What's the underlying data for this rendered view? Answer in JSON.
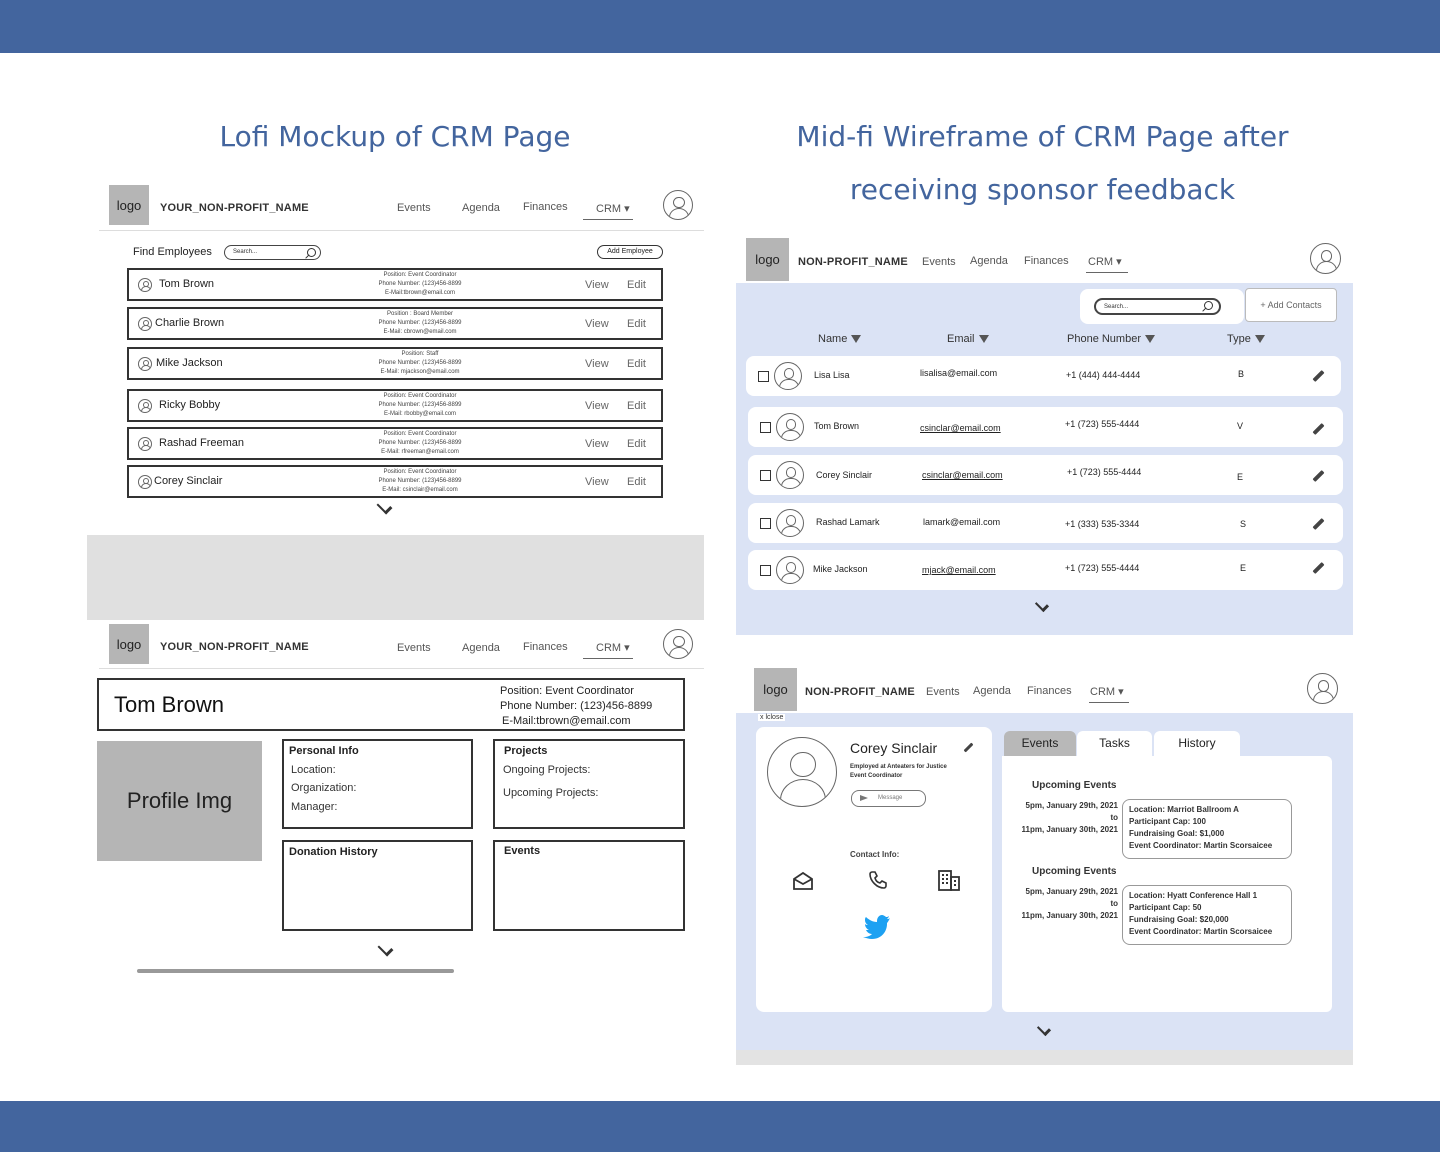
{
  "colors": {
    "accent": "#43659e",
    "midfi_panel": "#dbe3f5"
  },
  "headings": {
    "lofi": "Lofi Mockup of CRM Page",
    "midfi_line1": "Mid-fi Wireframe of CRM Page after",
    "midfi_line2": "receiving sponsor feedback"
  },
  "lofi_list": {
    "logo": "logo",
    "org": "YOUR_NON-PROFIT_NAME",
    "nav": [
      "Events",
      "Agenda",
      "Finances",
      "CRM ▾"
    ],
    "find_label": "Find Employees",
    "search_placeholder": "Search...",
    "add_button": "Add Employee",
    "rows": [
      {
        "name": "Tom Brown",
        "l1": "Position: Event Coordinator",
        "l2": "Phone Number: (123)456-8899",
        "l3": "E-Mail:tbrown@email.com",
        "view": "View",
        "edit": "Edit"
      },
      {
        "name": "Charlie Brown",
        "l1": "Position : Board Member",
        "l2": "Phone Number: (123)456-8899",
        "l3": "E-Mail: cbrown@email.com",
        "view": "View",
        "edit": "Edit"
      },
      {
        "name": "Mike Jackson",
        "l1": "Position: Staff",
        "l2": "Phone Number: (123)456-8899",
        "l3": "E-Mail: mjackson@email.com",
        "view": "View",
        "edit": "Edit"
      },
      {
        "name": "Ricky Bobby",
        "l1": "Position: Event Coordinator",
        "l2": "Phone Number: (123)456-8899",
        "l3": "E-Mail: rbobby@email.com",
        "view": "View",
        "edit": "Edit"
      },
      {
        "name": "Rashad Freeman",
        "l1": "Position: Event Coordinator",
        "l2": "Phone Number: (123)456-8899",
        "l3": "E-Mail: rfreeman@email.com",
        "view": "View",
        "edit": "Edit"
      },
      {
        "name": "Corey Sinclair",
        "l1": "Position: Event Coordinator",
        "l2": "Phone Number: (123)456-8899",
        "l3": "E-Mail: csinclair@email.com",
        "view": "View",
        "edit": "Edit"
      }
    ]
  },
  "lofi_profile": {
    "logo": "logo",
    "org": "YOUR_NON-PROFIT_NAME",
    "nav": [
      "Events",
      "Agenda",
      "Finances",
      "CRM ▾"
    ],
    "name": "Tom Brown",
    "position": "Position: Event Coordinator",
    "phone": "Phone Number: (123)456-8899",
    "email": "E-Mail:tbrown@email.com",
    "profile_img": "Profile Img",
    "personal_info": {
      "title": "Personal Info",
      "fields": [
        "Location:",
        "Organization:",
        "Manager:"
      ]
    },
    "projects": {
      "title": "Projects",
      "fields": [
        "Ongoing Projects:",
        "Upcoming Projects:"
      ]
    },
    "donation_history": "Donation History",
    "events": "Events"
  },
  "midfi_list": {
    "logo": "logo",
    "org": "NON-PROFIT_NAME",
    "nav": [
      "Events",
      "Agenda",
      "Finances",
      "CRM ▾"
    ],
    "search_placeholder": "Search...",
    "add_button": "+ Add Contacts",
    "columns": [
      "Name",
      "Email",
      "Phone Number",
      "Type"
    ],
    "rows": [
      {
        "name": "Lisa Lisa",
        "email": "lisalisa@email.com",
        "phone": "+1 (444) 444-4444",
        "type": "B"
      },
      {
        "name": "Tom Brown",
        "email": "csinclar@email.com",
        "phone": "+1 (723) 555-4444",
        "type": "V"
      },
      {
        "name": "Corey Sinclair",
        "email": "csinclar@email.com",
        "phone": "+1 (723) 555-4444",
        "type": "E"
      },
      {
        "name": "Rashad Lamark",
        "email": "lamark@email.com",
        "phone": "+1 (333) 535-3344",
        "type": "S"
      },
      {
        "name": "Mike Jackson",
        "email": "mjack@email.com",
        "phone": "+1 (723) 555-4444",
        "type": "E"
      }
    ]
  },
  "midfi_profile": {
    "logo": "logo",
    "org": "NON-PROFIT_NAME",
    "nav": [
      "Events",
      "Agenda",
      "Finances",
      "CRM ▾"
    ],
    "close": "x lclose",
    "name": "Corey Sinclair",
    "employed_prefix": "Employed at ",
    "employer": "Anteaters for Justice",
    "role": "Event Coordinator",
    "message_button": "Message",
    "contact_label": "Contact Info:",
    "tabs": [
      "Events",
      "Tasks",
      "History"
    ],
    "sections": [
      {
        "title": "Upcoming Events",
        "date_start": "5pm, January 29th, 2021",
        "to": "to",
        "date_end": "11pm, January 30th, 2021",
        "lines": [
          "Location: Marriot Ballroom A",
          "Participant Cap: 100",
          "Fundraising Goal: $1,000",
          "Event Coordinator: Martin Scorsaicee"
        ]
      },
      {
        "title": "Upcoming Events",
        "date_start": "5pm, January 29th, 2021",
        "to": "to",
        "date_end": "11pm, January 30th, 2021",
        "lines": [
          "Location: Hyatt Conference Hall 1",
          "Participant Cap: 50",
          "Fundraising Goal: $20,000",
          "Event Coordinator: Martin Scorsaicee"
        ]
      }
    ]
  }
}
